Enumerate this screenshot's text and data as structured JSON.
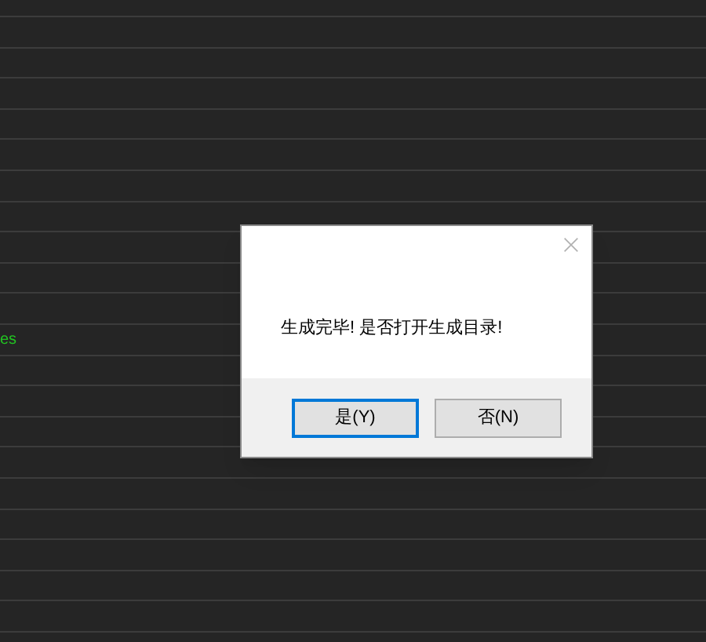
{
  "console": {
    "lines": [
      {
        "text": "es"
      }
    ]
  },
  "dialog": {
    "message": "生成完毕! 是否打开生成目录!",
    "buttons": [
      {
        "label": "是(Y)",
        "focused": true
      },
      {
        "label": "否(N)",
        "focused": false
      }
    ]
  }
}
